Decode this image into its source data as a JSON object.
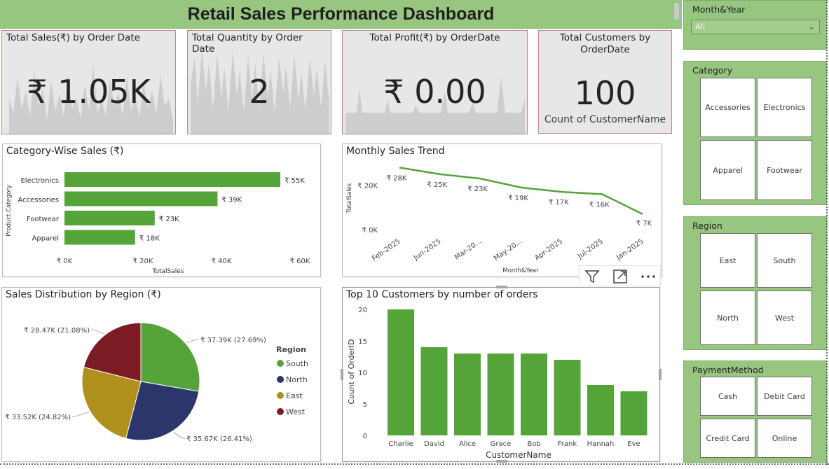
{
  "dashboard": {
    "title": "Retail Sales Performance Dashboard"
  },
  "kpis": {
    "sales": {
      "title": "Total Sales(₹) by Order Date",
      "value": "₹ 1.05K"
    },
    "quantity": {
      "title": "Total Quantity by Order Date",
      "value": "2"
    },
    "profit": {
      "title": "Total Profit(₹) by OrderDate",
      "value": "₹ 0.00"
    },
    "customers": {
      "title": "Total Customers by OrderDate",
      "value": "100",
      "subtitle": "Count of CustomerName"
    }
  },
  "colors": {
    "green": "#55a43a",
    "navy": "#2b366b",
    "gold": "#b0901c",
    "maroon": "#7c1b23",
    "header": "#97c680"
  },
  "visual_header_icons": [
    "filter-icon",
    "focus-mode-icon",
    "more-options-icon"
  ],
  "slicers": {
    "month_year": {
      "title": "Month&Year",
      "selected": "All"
    },
    "category": {
      "title": "Category",
      "options": [
        "Accessories",
        "Electronics",
        "Apparel",
        "Footwear"
      ]
    },
    "region": {
      "title": "Region",
      "options": [
        "East",
        "South",
        "North",
        "West"
      ]
    },
    "payment": {
      "title": "PaymentMethod",
      "options": [
        "Cash",
        "Debit Card",
        "Credit Card",
        "Online"
      ]
    }
  },
  "chart_data": [
    {
      "id": "category_sales",
      "type": "bar",
      "orientation": "horizontal",
      "title": "Category-Wise Sales (₹)",
      "xlabel": "TotalSales",
      "ylabel": "Product Category",
      "categories": [
        "Electronics",
        "Accessories",
        "Footwear",
        "Apparel"
      ],
      "values": [
        55000,
        39000,
        23000,
        18000
      ],
      "data_labels": [
        "₹ 55K",
        "₹ 39K",
        "₹ 23K",
        "₹ 18K"
      ],
      "xlim": [
        0,
        60000
      ],
      "xticks": [
        0,
        20000,
        40000,
        60000
      ],
      "xtick_labels": [
        "₹ 0K",
        "₹ 20K",
        "₹ 40K",
        "₹ 60K"
      ],
      "color": "#55a43a"
    },
    {
      "id": "monthly_trend",
      "type": "line",
      "title": "Monthly Sales Trend",
      "xlabel": "Month&Year",
      "ylabel": "TotalSales",
      "x": [
        "Feb-2025",
        "Jun-2025",
        "Mar-20...",
        "May-20...",
        "Apr-2025",
        "Jul-2025",
        "Jan-2025"
      ],
      "values": [
        28000,
        25000,
        23000,
        19000,
        17000,
        16000,
        7000
      ],
      "data_labels": [
        "₹ 28K",
        "₹ 25K",
        "₹ 23K",
        "₹ 19K",
        "₹ 17K",
        "₹ 16K",
        "₹ 7K"
      ],
      "ylim": [
        0,
        30000
      ],
      "yticks": [
        0,
        20000
      ],
      "ytick_labels": [
        "₹ 0K",
        "₹ 20K"
      ],
      "color": "#55a43a"
    },
    {
      "id": "region_pie",
      "type": "pie",
      "title": "Sales Distribution by Region (₹)",
      "legend_title": "Region",
      "legend_position": "right",
      "slices": [
        {
          "name": "South",
          "value": 37390,
          "label": "₹ 37.39K (27.69%)",
          "color": "#55a43a"
        },
        {
          "name": "North",
          "value": 35670,
          "label": "₹ 35.67K (26.41%)",
          "color": "#2b366b"
        },
        {
          "name": "East",
          "value": 33520,
          "label": "₹ 33.52K (24.82%)",
          "color": "#b0901c"
        },
        {
          "name": "West",
          "value": 28470,
          "label": "₹ 28.47K (21.08%)",
          "color": "#7c1b23"
        }
      ]
    },
    {
      "id": "top_customers",
      "type": "bar",
      "title": "Top 10 Customers by number of orders",
      "xlabel": "CustomerName",
      "ylabel": "Count of OrderID",
      "categories": [
        "Charlie",
        "David",
        "Alice",
        "Grace",
        "Bob",
        "Frank",
        "Hannah",
        "Eve"
      ],
      "values": [
        20,
        14,
        13,
        13,
        13,
        12,
        8,
        7
      ],
      "ylim": [
        0,
        20
      ],
      "yticks": [
        0,
        5,
        10,
        15,
        20
      ],
      "color": "#55a43a"
    }
  ]
}
